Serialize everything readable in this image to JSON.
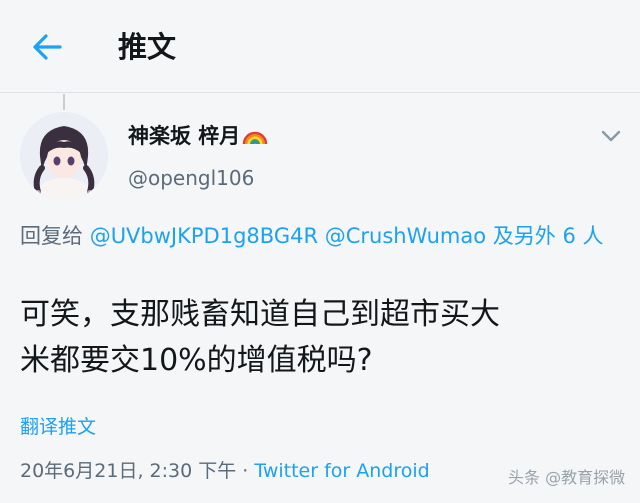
{
  "header": {
    "title": "推文",
    "back_icon": "arrow-left-icon"
  },
  "tweet": {
    "display_name": "神楽坂 梓月",
    "emoji": "rainbow-icon",
    "handle": "@opengl106",
    "reply": {
      "prefix": "回复给 ",
      "mention1": "@UVbwJKPD1g8BG4R",
      "mention2": "@CrushWumao",
      "others": "及另外 6 人"
    },
    "text_line1": "可笑，支那贱畜知道自己到超市买大",
    "text_line2": "米都要交10%的增值税吗?",
    "translate_label": "翻译推文",
    "timestamp": "20年6月21日, 2:30 下午 · ",
    "source": "Twitter for Android"
  },
  "watermark": "头条 @教育探微",
  "colors": {
    "accent": "#1da1f2",
    "muted": "#5b6b7a",
    "text": "#14171a",
    "background": "#f4f6f8"
  }
}
